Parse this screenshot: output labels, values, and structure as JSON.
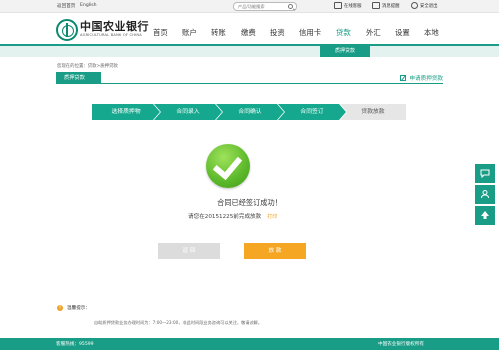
{
  "topbar": {
    "home_link": "返回首页",
    "english_link": "English",
    "search_placeholder": "产品/功能搜索",
    "online_service": "在线客服",
    "messages": "消息提醒",
    "logout": "安全退出"
  },
  "brand": {
    "name_cn": "中国农业银行",
    "name_en": "AGRICULTURAL BANK OF CHINA"
  },
  "nav": [
    "首页",
    "账户",
    "转账",
    "缴费",
    "投资",
    "信用卡",
    "贷款",
    "外汇",
    "设置",
    "本地"
  ],
  "subnav": {
    "active": "质押贷款"
  },
  "breadcrumb": "您现在的位置：贷款>质押贷款",
  "section": {
    "tab": "质押贷款",
    "apply_link": "申请质押贷款"
  },
  "steps": [
    "选择质押物",
    "合同录入",
    "合同确认",
    "合同签订",
    "贷款放款"
  ],
  "result": {
    "title": "合同已经签订成功！",
    "note": "请您在20151225前完成放款",
    "print": "打印"
  },
  "buttons": {
    "back": "返 回",
    "disburse": "放 款"
  },
  "tips": {
    "heading": "温馨提示：",
    "text": "自助质押贷款业务办理时间为：7:00—23:00，非此时间段业务咨询可以关注，敬请谅解。"
  },
  "footer": {
    "hotline": "客服热线：95599",
    "copyright": "中国农业银行版权所有"
  },
  "colors": {
    "primary": "#1a9d86",
    "accent": "#f5a623",
    "success": "#5cb82a"
  },
  "icons": [
    "search-icon",
    "service-icon",
    "message-icon",
    "logout-icon",
    "edit-icon",
    "check-icon",
    "info-icon",
    "chat-icon",
    "user-icon",
    "up-arrow-icon"
  ]
}
